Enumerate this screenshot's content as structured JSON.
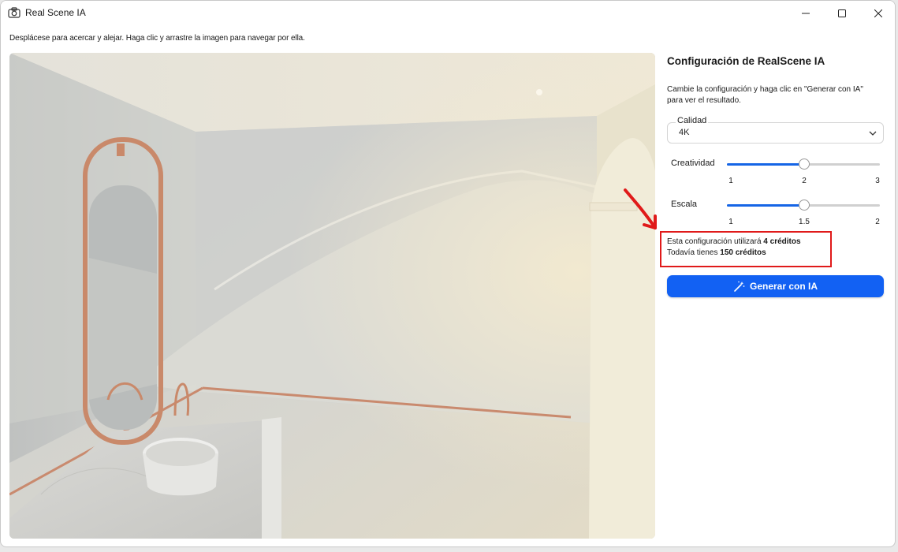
{
  "window": {
    "title": "Real Scene IA",
    "icons": {
      "app": "camera-icon",
      "minimize": "minimize-icon",
      "maximize": "maximize-icon",
      "close": "close-icon"
    }
  },
  "hint": "Desplácese para acercar y alejar. Haga clic y arrastre la imagen para navegar por ella.",
  "toolbar": {
    "buttons": [
      {
        "name": "save-button",
        "icon": "floppy-disk-icon"
      },
      {
        "name": "copy-button",
        "icon": "copy-icon"
      },
      {
        "name": "image-settings-button",
        "icon": "image-gear-icon"
      },
      {
        "name": "image-edit-button",
        "icon": "image-pencil-icon"
      },
      {
        "name": "send-button",
        "icon": "paper-plane-icon"
      }
    ]
  },
  "panel": {
    "title": "Configuración de RealScene IA",
    "description": "Cambie la configuración y haga clic en \"Generar con IA\" para ver el resultado.",
    "quality": {
      "label": "Calidad",
      "value": "4K"
    },
    "creativity": {
      "label": "Creatividad",
      "ticks": [
        "1",
        "2",
        "3"
      ],
      "min": 1,
      "max": 3,
      "value": 2
    },
    "scale": {
      "label": "Escala",
      "ticks": [
        "1",
        "1.5",
        "2"
      ],
      "min": 1,
      "max": 2,
      "value": 1.5
    },
    "credits": {
      "line1_prefix": "Esta configuración utilizará ",
      "line1_value": "4 créditos",
      "line2_prefix": "Todavía tienes ",
      "line2_value": "150 créditos"
    },
    "generate_label": "Generar con IA",
    "generate_icon": "magic-wand-icon"
  },
  "colors": {
    "accent": "#1261f3",
    "highlight": "#e01a1a",
    "slider_fill": "#1565e6"
  }
}
